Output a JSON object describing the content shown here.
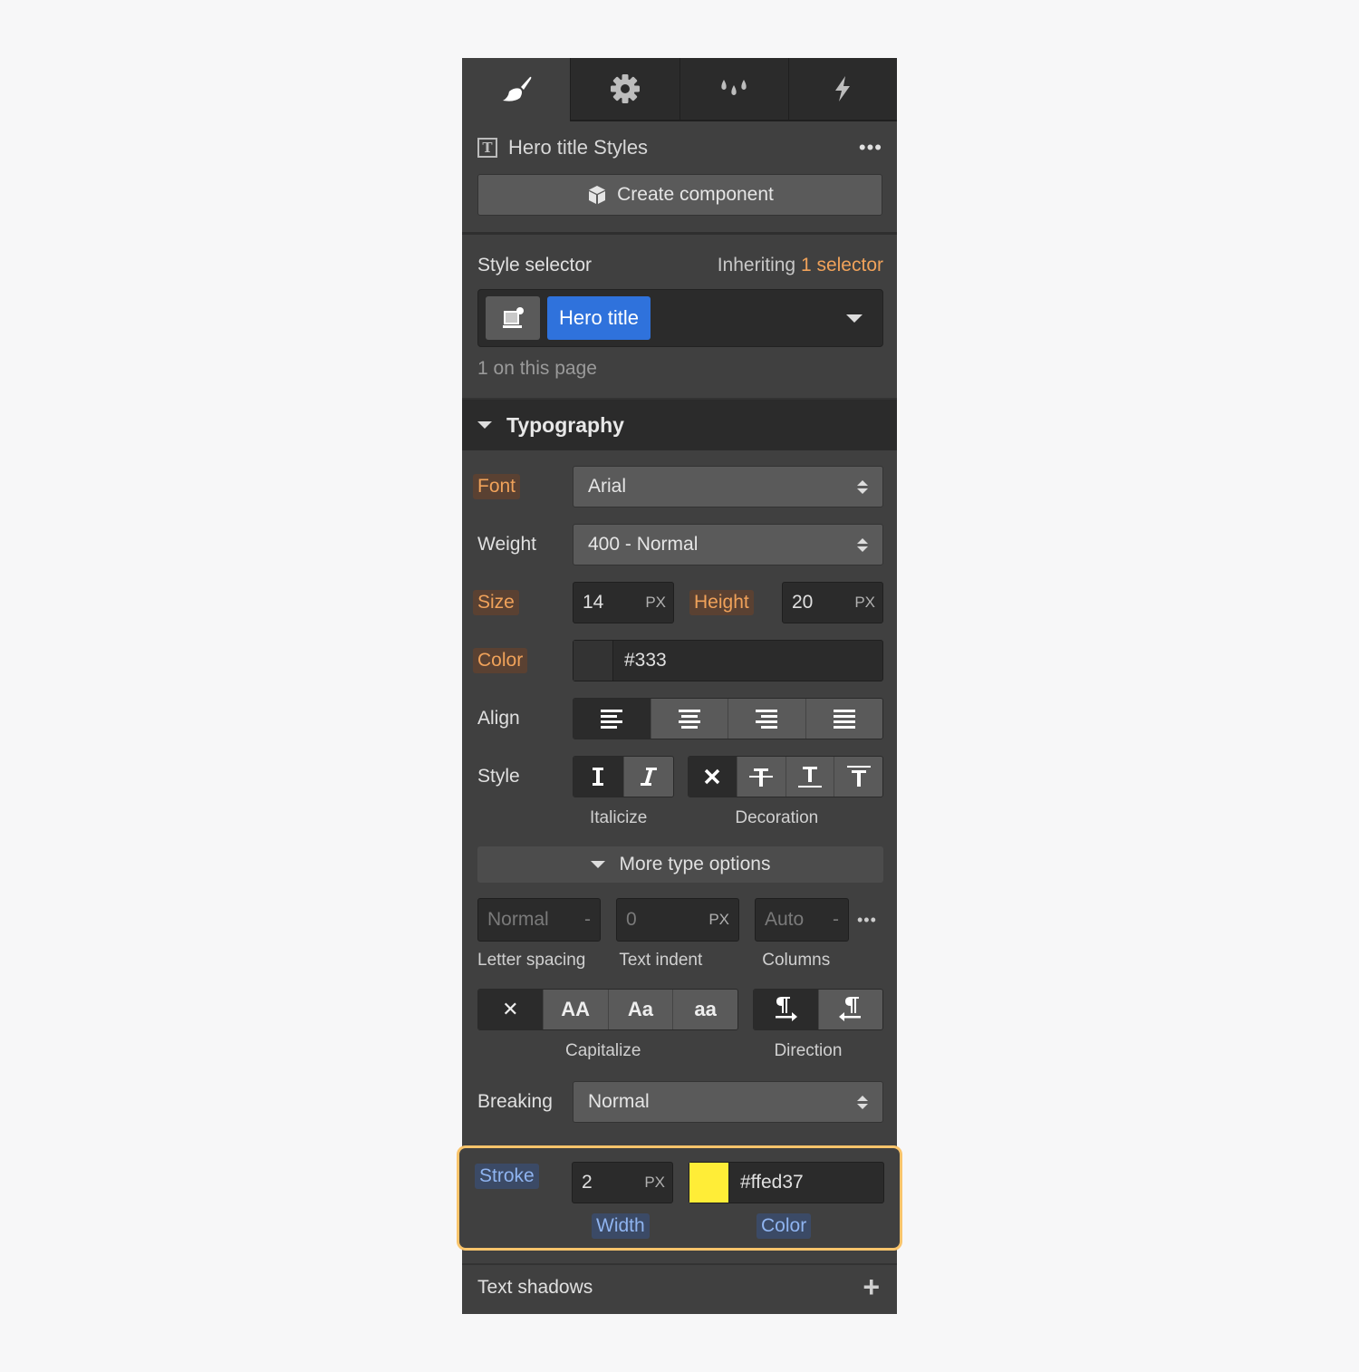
{
  "tabs": [
    {
      "name": "style",
      "icon": "paintbrush-icon",
      "active": true
    },
    {
      "name": "settings",
      "icon": "gear-icon",
      "active": false
    },
    {
      "name": "color",
      "icon": "droplets-icon",
      "active": false
    },
    {
      "name": "interactions",
      "icon": "lightning-icon",
      "active": false
    }
  ],
  "header": {
    "element_icon": "T",
    "title": "Hero title Styles",
    "more": "•••",
    "create_component": "Create component"
  },
  "style_selector": {
    "label": "Style selector",
    "inheriting_prefix": "Inheriting",
    "inheriting_count": "1 selector",
    "chip": "Hero title",
    "on_page": "1 on this page"
  },
  "typography": {
    "title": "Typography",
    "font_label": "Font",
    "font_value": "Arial",
    "weight_label": "Weight",
    "weight_value": "400 - Normal",
    "size_label": "Size",
    "size_value": "14",
    "size_unit": "PX",
    "height_label": "Height",
    "height_value": "20",
    "height_unit": "PX",
    "color_label": "Color",
    "color_value": "#333",
    "color_swatch": "#333333",
    "align_label": "Align",
    "align_options": [
      "left",
      "center",
      "right",
      "justify"
    ],
    "align_selected": "left",
    "style_label": "Style",
    "italicize_label": "Italicize",
    "decoration_label": "Decoration",
    "more_options": "More type options",
    "letter_spacing_value": "Normal",
    "letter_spacing_suffix": "-",
    "letter_spacing_label": "Letter spacing",
    "text_indent_value": "0",
    "text_indent_unit": "PX",
    "text_indent_label": "Text indent",
    "columns_value": "Auto",
    "columns_suffix": "-",
    "columns_label": "Columns",
    "columns_more": "•••",
    "capitalize_options": [
      "✕",
      "AA",
      "Aa",
      "aa"
    ],
    "capitalize_label": "Capitalize",
    "direction_label": "Direction",
    "breaking_label": "Breaking",
    "breaking_value": "Normal"
  },
  "stroke": {
    "label": "Stroke",
    "width_value": "2",
    "width_unit": "PX",
    "width_label": "Width",
    "color_value": "#ffed37",
    "color_swatch": "#ffed37",
    "color_label": "Color"
  },
  "text_shadows": {
    "label": "Text shadows",
    "add": "+"
  },
  "colors": {
    "accent_orange": "#f0a25a",
    "selector_blue": "#2f72dc",
    "highlight_border": "#f9c46b"
  }
}
